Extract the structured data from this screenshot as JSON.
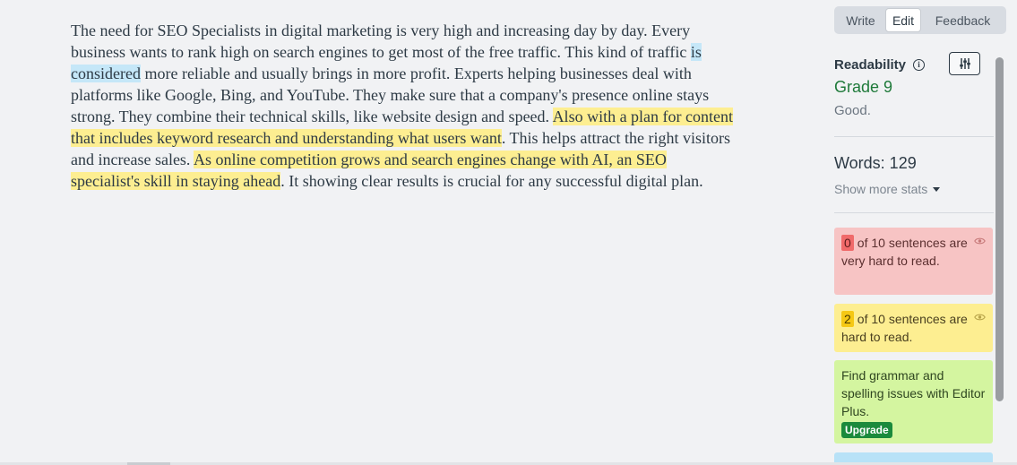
{
  "editor": {
    "segments": [
      {
        "text": "The need for SEO Specialists in digital marketing is very high and increasing day by day. Every business wants to rank high on search engines to get most of the free traffic. This kind of traffic ",
        "hl": ""
      },
      {
        "text": "is considered",
        "hl": "blue"
      },
      {
        "text": " more reliable and usually brings in more profit. Experts helping businesses deal with platforms like Google, Bing, and YouTube. They make sure that a company's presence online stays strong. They combine their technical skills, like website design and speed. ",
        "hl": ""
      },
      {
        "text": "Also with a plan for content that includes keyword research and understanding what users want",
        "hl": "yellow"
      },
      {
        "text": ". This helps attract the right visitors and increase sales. ",
        "hl": ""
      },
      {
        "text": "As online competition grows and search engines change with AI, an SEO specialist's skill in staying ahead",
        "hl": "yellow"
      },
      {
        "text": ". It showing clear results is crucial for any successful digital plan.",
        "hl": ""
      }
    ]
  },
  "sidebar": {
    "tabs": {
      "write": "Write",
      "edit": "Edit",
      "feedback": "Feedback"
    },
    "readability_label": "Readability",
    "info_icon_glyph": "i",
    "grade": "Grade 9",
    "grade_desc": "Good.",
    "words": "Words: 129",
    "show_more_stats": "Show more stats",
    "cards": {
      "very_hard": {
        "count": "0",
        "text": "of 10 sentences are very hard to read."
      },
      "hard": {
        "count": "2",
        "text": "of 10 sentences are hard to read."
      },
      "editor_plus": {
        "text": "Find grammar and spelling issues with Editor Plus.",
        "button": "Upgrade"
      }
    }
  },
  "colors": {
    "highlight_blue": "#c5e7f8",
    "highlight_yellow": "#fdee91",
    "grade_green": "#1f7a3a",
    "upgrade_green": "#1b8a3c"
  },
  "icons": {
    "info": "info-icon",
    "settings": "sliders-icon",
    "eye": "eye-icon",
    "caret": "caret-down-icon"
  }
}
